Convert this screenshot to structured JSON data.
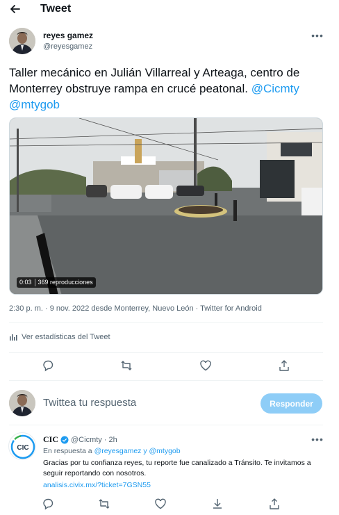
{
  "header": {
    "title": "Tweet",
    "back_icon": "arrow-left-icon"
  },
  "tweet": {
    "author_name": "reyes gamez",
    "author_handle": "@reyesgamez",
    "text": "Taller mecánico en Julián Villarreal y Arteaga, centro de Monterrey obstruye rampa en crucé peatonal.",
    "mentions": [
      "@Cicmty",
      "@mtygob"
    ],
    "video": {
      "time": "0:03",
      "views": "369 reproducciones"
    },
    "meta": "2:30 p. m. · 9 nov. 2022 desde Monterrey, Nuevo León · Twitter for Android",
    "stats_label": "Ver estadísticas del Tweet",
    "actions": [
      "reply-icon",
      "retweet-icon",
      "like-icon",
      "share-icon"
    ]
  },
  "composer": {
    "placeholder": "Twittea tu respuesta",
    "button_label": "Responder"
  },
  "reply": {
    "author_name": "CIC",
    "author_handle": "@Cicmty",
    "time": "· 2h",
    "in_reply_prefix": "En respuesta a",
    "in_reply_mentions": "@reyesgamez y @mtygob",
    "body": "Gracias por tu confianza reyes, tu reporte fue canalizado a Tránsito. Te invitamos a seguir reportando con nosotros.",
    "link": "analisis.civix.mx/?ticket=7GSN55",
    "avatar_text": "CIC",
    "actions": [
      "reply-icon",
      "retweet-icon",
      "like-icon",
      "download-icon",
      "share-icon"
    ]
  },
  "colors": {
    "accent": "#1d9bf0",
    "reply_button": "#8ecdf7",
    "muted": "#536471"
  }
}
